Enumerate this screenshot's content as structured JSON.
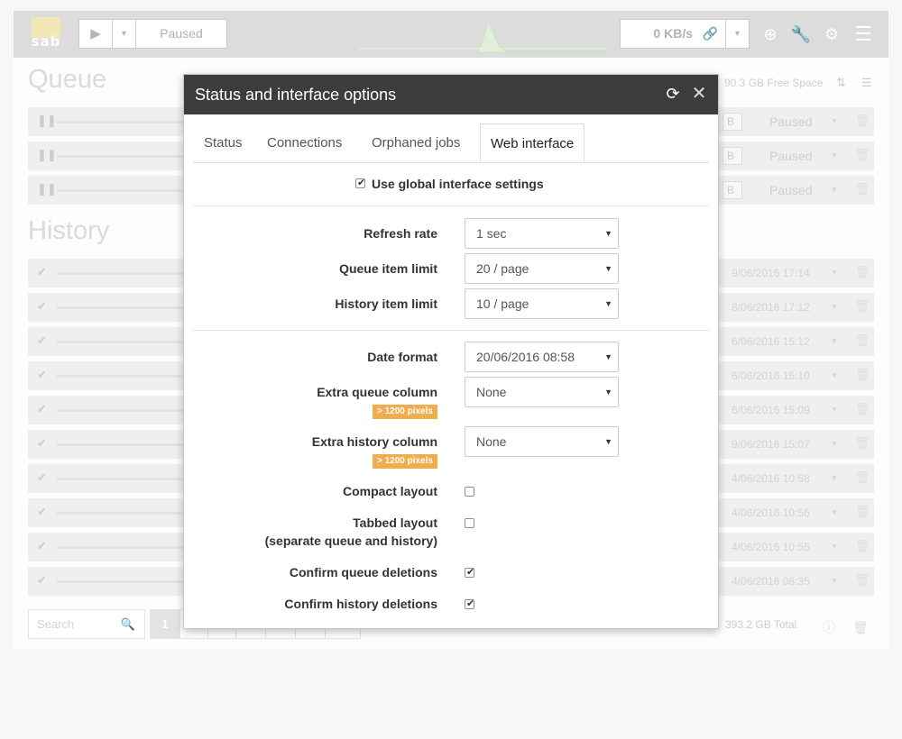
{
  "topbar": {
    "logo_text": "sab",
    "play_icon": "play-icon",
    "status_label": "Paused",
    "speed_value": "0 KB/s",
    "link_icon": "link-icon",
    "add_icon": "plus-circle-icon",
    "wrench_icon": "wrench-icon",
    "gear_icon": "gear-icon",
    "menu_icon": "hamburger-menu-icon"
  },
  "queue": {
    "heading": "Queue",
    "free_space": "90.3 GB Free Space",
    "rows": [
      {
        "status": "Paused",
        "tag": "B"
      },
      {
        "status": "Paused",
        "tag": "B"
      },
      {
        "status": "Paused",
        "tag": "B"
      }
    ]
  },
  "history": {
    "heading": "History",
    "rows": [
      {
        "date": "9/06/2016 17:14"
      },
      {
        "date": "8/06/2016 17:12"
      },
      {
        "date": "6/06/2016 15:12"
      },
      {
        "date": "6/06/2016 15:10"
      },
      {
        "date": "6/06/2016 15:09"
      },
      {
        "date": "9/06/2016 15:07"
      },
      {
        "date": "4/06/2016 10:58"
      },
      {
        "date": "4/06/2016 10:56"
      },
      {
        "date": "4/06/2016 10:55"
      },
      {
        "date": "4/06/2016 08:35"
      }
    ],
    "search_placeholder": "Search",
    "pages": [
      "1",
      "",
      "",
      "",
      "",
      "",
      ""
    ],
    "total": "393.2 GB Total"
  },
  "modal": {
    "title": "Status and interface options",
    "tabs": [
      "Status",
      "Connections",
      "Orphaned jobs",
      "Web interface"
    ],
    "active_tab": "Web interface",
    "global_settings_label": "Use global interface settings",
    "global_settings_checked": true,
    "fields": {
      "refresh_rate": {
        "label": "Refresh rate",
        "value": "1 sec"
      },
      "queue_limit": {
        "label": "Queue item limit",
        "value": "20 / page"
      },
      "history_limit": {
        "label": "History item limit",
        "value": "10 / page"
      },
      "date_format": {
        "label": "Date format",
        "value": "20/06/2016 08:58"
      },
      "extra_queue": {
        "label": "Extra queue column",
        "badge": "> 1200 pixels",
        "value": "None"
      },
      "extra_history": {
        "label": "Extra history column",
        "badge": "> 1200 pixels",
        "value": "None"
      },
      "compact_layout": {
        "label": "Compact layout",
        "checked": false
      },
      "tabbed_layout": {
        "label": "Tabbed layout",
        "sublabel": "(separate queue and history)",
        "checked": false
      },
      "confirm_queue": {
        "label": "Confirm queue deletions",
        "checked": true
      },
      "confirm_history": {
        "label": "Confirm history deletions",
        "checked": true
      }
    }
  },
  "colors": {
    "modal_header": "#3c3c3c",
    "badge": "#f0ad4e",
    "graph_fill": "#dff0d8"
  }
}
